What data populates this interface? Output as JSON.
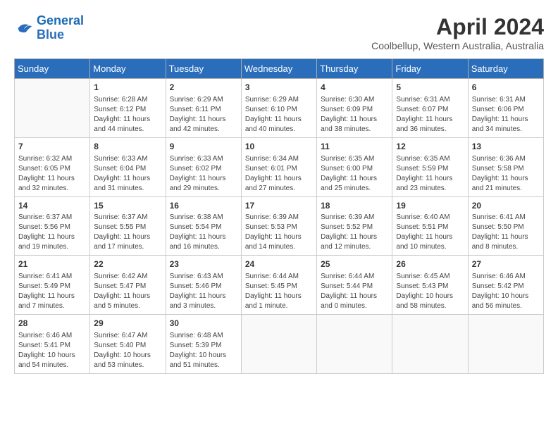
{
  "logo": {
    "line1": "General",
    "line2": "Blue"
  },
  "title": "April 2024",
  "subtitle": "Coolbellup, Western Australia, Australia",
  "weekdays": [
    "Sunday",
    "Monday",
    "Tuesday",
    "Wednesday",
    "Thursday",
    "Friday",
    "Saturday"
  ],
  "weeks": [
    [
      {
        "day": "",
        "info": ""
      },
      {
        "day": "1",
        "info": "Sunrise: 6:28 AM\nSunset: 6:12 PM\nDaylight: 11 hours\nand 44 minutes."
      },
      {
        "day": "2",
        "info": "Sunrise: 6:29 AM\nSunset: 6:11 PM\nDaylight: 11 hours\nand 42 minutes."
      },
      {
        "day": "3",
        "info": "Sunrise: 6:29 AM\nSunset: 6:10 PM\nDaylight: 11 hours\nand 40 minutes."
      },
      {
        "day": "4",
        "info": "Sunrise: 6:30 AM\nSunset: 6:09 PM\nDaylight: 11 hours\nand 38 minutes."
      },
      {
        "day": "5",
        "info": "Sunrise: 6:31 AM\nSunset: 6:07 PM\nDaylight: 11 hours\nand 36 minutes."
      },
      {
        "day": "6",
        "info": "Sunrise: 6:31 AM\nSunset: 6:06 PM\nDaylight: 11 hours\nand 34 minutes."
      }
    ],
    [
      {
        "day": "7",
        "info": "Sunrise: 6:32 AM\nSunset: 6:05 PM\nDaylight: 11 hours\nand 32 minutes."
      },
      {
        "day": "8",
        "info": "Sunrise: 6:33 AM\nSunset: 6:04 PM\nDaylight: 11 hours\nand 31 minutes."
      },
      {
        "day": "9",
        "info": "Sunrise: 6:33 AM\nSunset: 6:02 PM\nDaylight: 11 hours\nand 29 minutes."
      },
      {
        "day": "10",
        "info": "Sunrise: 6:34 AM\nSunset: 6:01 PM\nDaylight: 11 hours\nand 27 minutes."
      },
      {
        "day": "11",
        "info": "Sunrise: 6:35 AM\nSunset: 6:00 PM\nDaylight: 11 hours\nand 25 minutes."
      },
      {
        "day": "12",
        "info": "Sunrise: 6:35 AM\nSunset: 5:59 PM\nDaylight: 11 hours\nand 23 minutes."
      },
      {
        "day": "13",
        "info": "Sunrise: 6:36 AM\nSunset: 5:58 PM\nDaylight: 11 hours\nand 21 minutes."
      }
    ],
    [
      {
        "day": "14",
        "info": "Sunrise: 6:37 AM\nSunset: 5:56 PM\nDaylight: 11 hours\nand 19 minutes."
      },
      {
        "day": "15",
        "info": "Sunrise: 6:37 AM\nSunset: 5:55 PM\nDaylight: 11 hours\nand 17 minutes."
      },
      {
        "day": "16",
        "info": "Sunrise: 6:38 AM\nSunset: 5:54 PM\nDaylight: 11 hours\nand 16 minutes."
      },
      {
        "day": "17",
        "info": "Sunrise: 6:39 AM\nSunset: 5:53 PM\nDaylight: 11 hours\nand 14 minutes."
      },
      {
        "day": "18",
        "info": "Sunrise: 6:39 AM\nSunset: 5:52 PM\nDaylight: 11 hours\nand 12 minutes."
      },
      {
        "day": "19",
        "info": "Sunrise: 6:40 AM\nSunset: 5:51 PM\nDaylight: 11 hours\nand 10 minutes."
      },
      {
        "day": "20",
        "info": "Sunrise: 6:41 AM\nSunset: 5:50 PM\nDaylight: 11 hours\nand 8 minutes."
      }
    ],
    [
      {
        "day": "21",
        "info": "Sunrise: 6:41 AM\nSunset: 5:49 PM\nDaylight: 11 hours\nand 7 minutes."
      },
      {
        "day": "22",
        "info": "Sunrise: 6:42 AM\nSunset: 5:47 PM\nDaylight: 11 hours\nand 5 minutes."
      },
      {
        "day": "23",
        "info": "Sunrise: 6:43 AM\nSunset: 5:46 PM\nDaylight: 11 hours\nand 3 minutes."
      },
      {
        "day": "24",
        "info": "Sunrise: 6:44 AM\nSunset: 5:45 PM\nDaylight: 11 hours\nand 1 minute."
      },
      {
        "day": "25",
        "info": "Sunrise: 6:44 AM\nSunset: 5:44 PM\nDaylight: 11 hours\nand 0 minutes."
      },
      {
        "day": "26",
        "info": "Sunrise: 6:45 AM\nSunset: 5:43 PM\nDaylight: 10 hours\nand 58 minutes."
      },
      {
        "day": "27",
        "info": "Sunrise: 6:46 AM\nSunset: 5:42 PM\nDaylight: 10 hours\nand 56 minutes."
      }
    ],
    [
      {
        "day": "28",
        "info": "Sunrise: 6:46 AM\nSunset: 5:41 PM\nDaylight: 10 hours\nand 54 minutes."
      },
      {
        "day": "29",
        "info": "Sunrise: 6:47 AM\nSunset: 5:40 PM\nDaylight: 10 hours\nand 53 minutes."
      },
      {
        "day": "30",
        "info": "Sunrise: 6:48 AM\nSunset: 5:39 PM\nDaylight: 10 hours\nand 51 minutes."
      },
      {
        "day": "",
        "info": ""
      },
      {
        "day": "",
        "info": ""
      },
      {
        "day": "",
        "info": ""
      },
      {
        "day": "",
        "info": ""
      }
    ]
  ]
}
